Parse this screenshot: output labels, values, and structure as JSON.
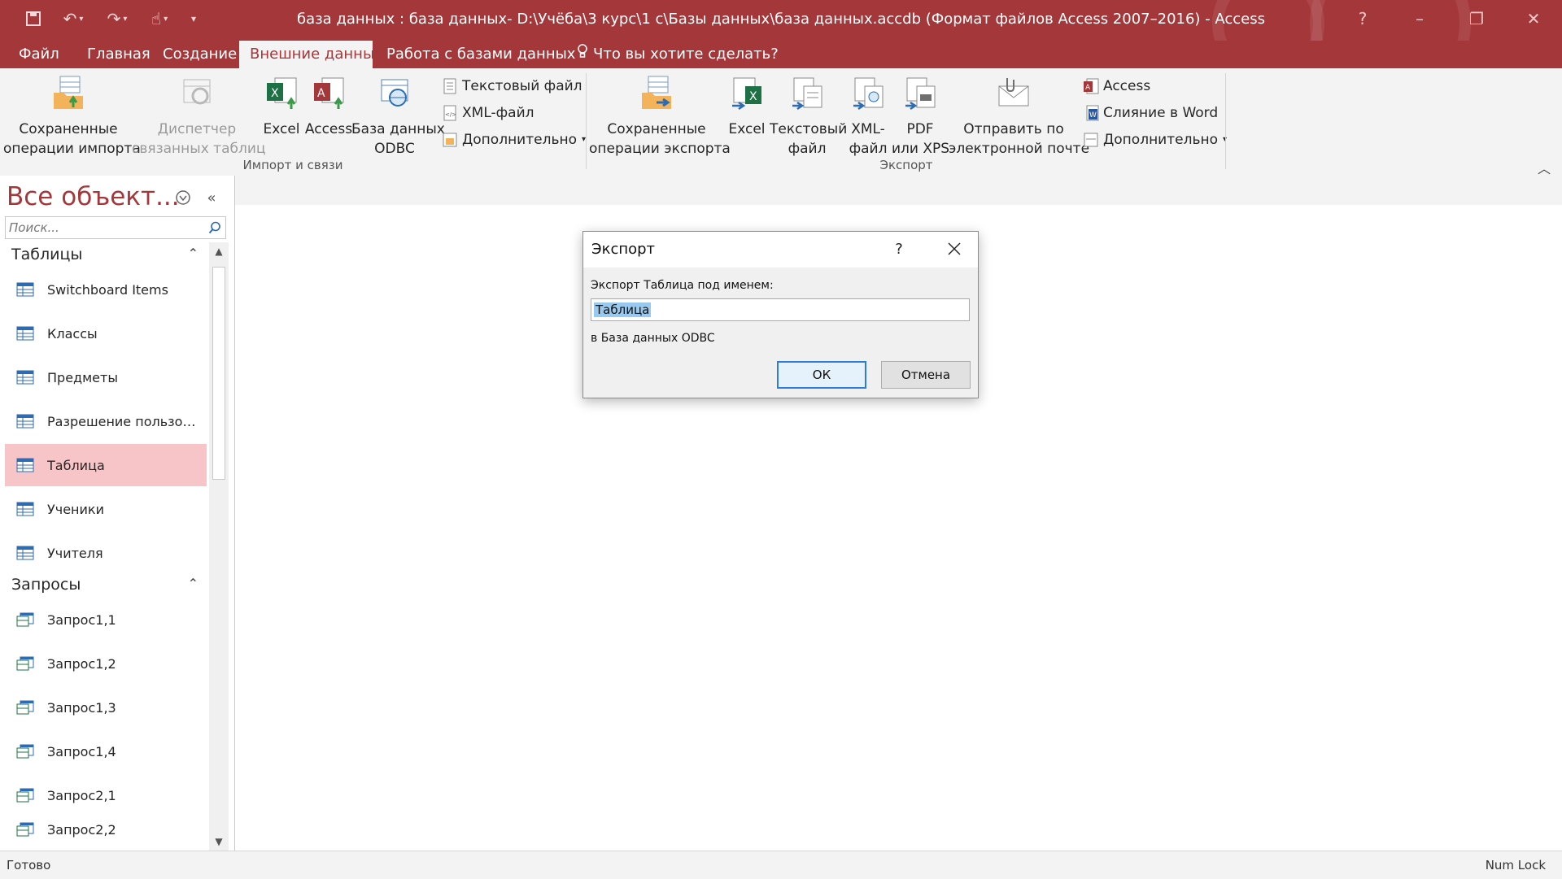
{
  "window": {
    "title": "база данных : база данных- D:\\Учёба\\3 курс\\1 с\\Базы данных\\база данных.accdb (Формат файлов Access 2007–2016) - Access",
    "controls": {
      "help": "?",
      "minimize": "–",
      "restore": "❐",
      "close": "✕"
    }
  },
  "tabs": [
    {
      "label": "Файл"
    },
    {
      "label": "Главная"
    },
    {
      "label": "Создание"
    },
    {
      "label": "Внешние данные",
      "active": true
    },
    {
      "label": "Работа с базами данных"
    },
    {
      "label": "Что вы хотите сделать?"
    }
  ],
  "ribbon": {
    "import_group": {
      "label": "Импорт и связи",
      "saved_imports": "Сохраненные\nоперации импорта",
      "linked_manager": "Диспетчер\nсвязанных таблиц",
      "excel": "Excel",
      "access": "Access",
      "odbc": "База данных\nODBC",
      "text_file": "Текстовый файл",
      "xml_file": "XML-файл",
      "more": "Дополнительно"
    },
    "export_group": {
      "label": "Экспорт",
      "saved_exports": "Сохраненные\nоперации экспорта",
      "excel": "Excel",
      "text_file": "Текстовый\nфайл",
      "xml_file": "XML-\nфайл",
      "pdf": "PDF\nили XPS",
      "email": "Отправить по\nэлектронной почте",
      "access": "Access",
      "word_merge": "Слияние в Word",
      "more": "Дополнительно"
    }
  },
  "nav": {
    "header": "Все объект...",
    "search_placeholder": "Поиск...",
    "sections": [
      {
        "title": "Таблицы",
        "items": [
          "Switchboard Items",
          "Классы",
          "Предметы",
          "Разрешение пользовате...",
          "Таблица",
          "Ученики",
          "Учителя"
        ],
        "selected": "Таблица"
      },
      {
        "title": "Запросы",
        "items": [
          "Запрос1,1",
          "Запрос1,2",
          "Запрос1,3",
          "Запрос1,4",
          "Запрос2,1",
          "Запрос2,2"
        ]
      }
    ]
  },
  "dialog": {
    "title": "Экспорт",
    "help": "?",
    "label": "Экспорт Таблица под именем:",
    "value": "Таблица",
    "target": "в База данных ODBC",
    "ok": "ОК",
    "cancel": "Отмена"
  },
  "status": {
    "left": "Готово",
    "right": "Num Lock"
  },
  "colors": {
    "accent": "#a4373a",
    "selection": "#f7c5c8",
    "ribbon_bg": "#f3f3f3"
  }
}
